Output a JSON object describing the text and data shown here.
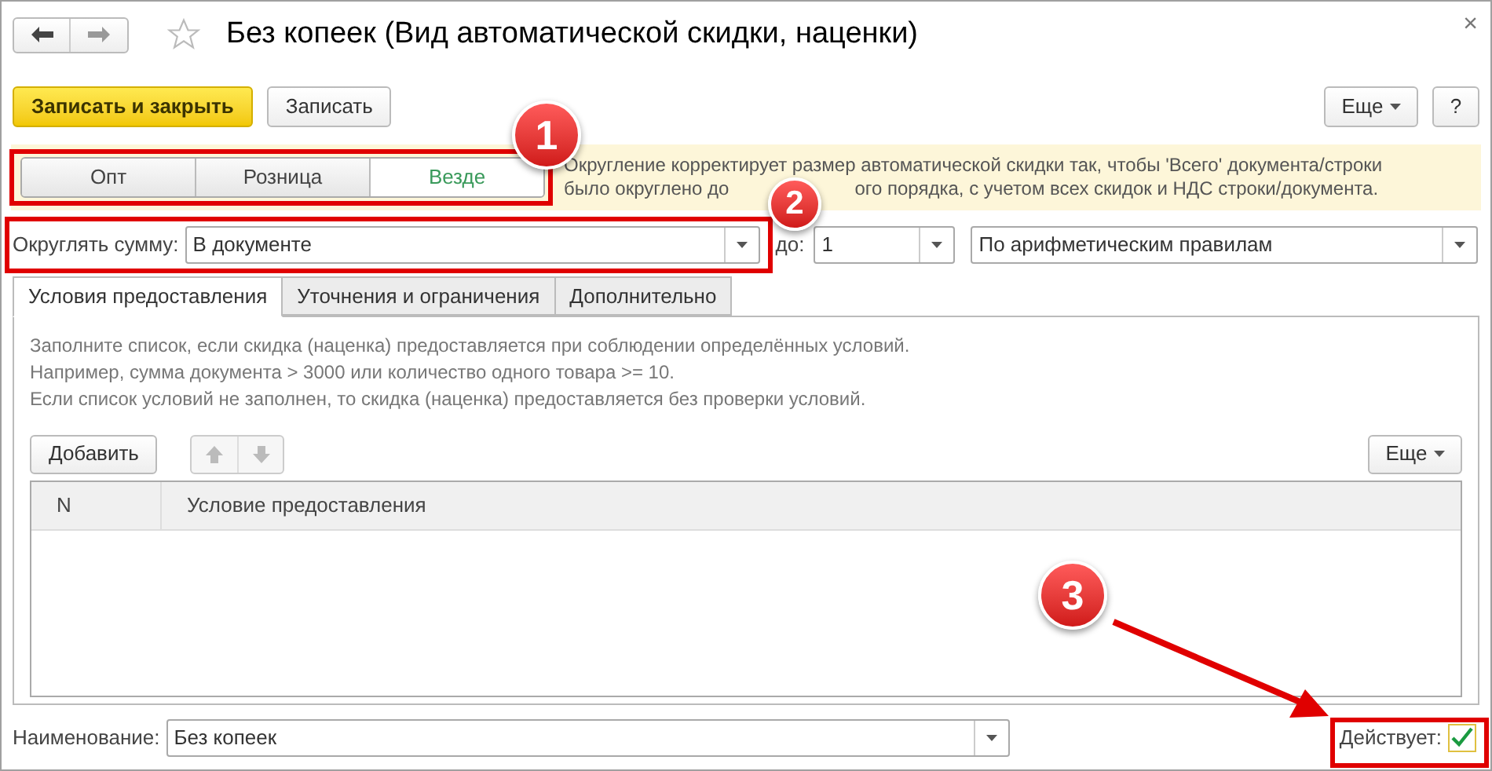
{
  "window": {
    "title": "Без копеек (Вид автоматической скидки, наценки)",
    "close": "×"
  },
  "toolbar": {
    "buttons": [
      {
        "label": "Записать и закрыть",
        "kind": "primary"
      },
      {
        "label": "Записать",
        "kind": "plain"
      }
    ],
    "more": "Еще",
    "help": "?"
  },
  "segments": [
    {
      "label": "Опт",
      "selected": false
    },
    {
      "label": "Розница",
      "selected": false
    },
    {
      "label": "Везде",
      "selected": true
    }
  ],
  "info": {
    "line_1": "Округление корректирует размер автоматической скидки так, чтобы 'Всего' документа/строки",
    "line_2_start": "было округлено до",
    "line_2_end": "ого порядка, с учетом всех скидок и НДС строки/документа."
  },
  "rounding": {
    "label": "Округлять сумму:",
    "value": "В документе",
    "to_label": "до:",
    "to_value": "1",
    "method": "По арифметическим правилам"
  },
  "tabs": [
    {
      "label": "Условия предоставления",
      "selected": true
    },
    {
      "label": "Уточнения и ограничения",
      "selected": false
    },
    {
      "label": "Дополнительно",
      "selected": false
    }
  ],
  "hint_lines": [
    "Заполните список, если скидка (наценка) предоставляется при соблюдении определённых условий.",
    "Например, сумма документа > 3000 или количество одного товара >= 10.",
    "Если список условий не заполнен, то скидка (наценка) предоставляется без проверки условий."
  ],
  "list_toolbar": {
    "add": "Добавить",
    "more": "Еще"
  },
  "table": {
    "columns": [
      "N",
      "Условие предоставления"
    ]
  },
  "name": {
    "label": "Наименование:",
    "value": "Без копеек"
  },
  "active": {
    "label": "Действует:",
    "checked": true
  },
  "annotations": [
    "1",
    "2",
    "3"
  ]
}
